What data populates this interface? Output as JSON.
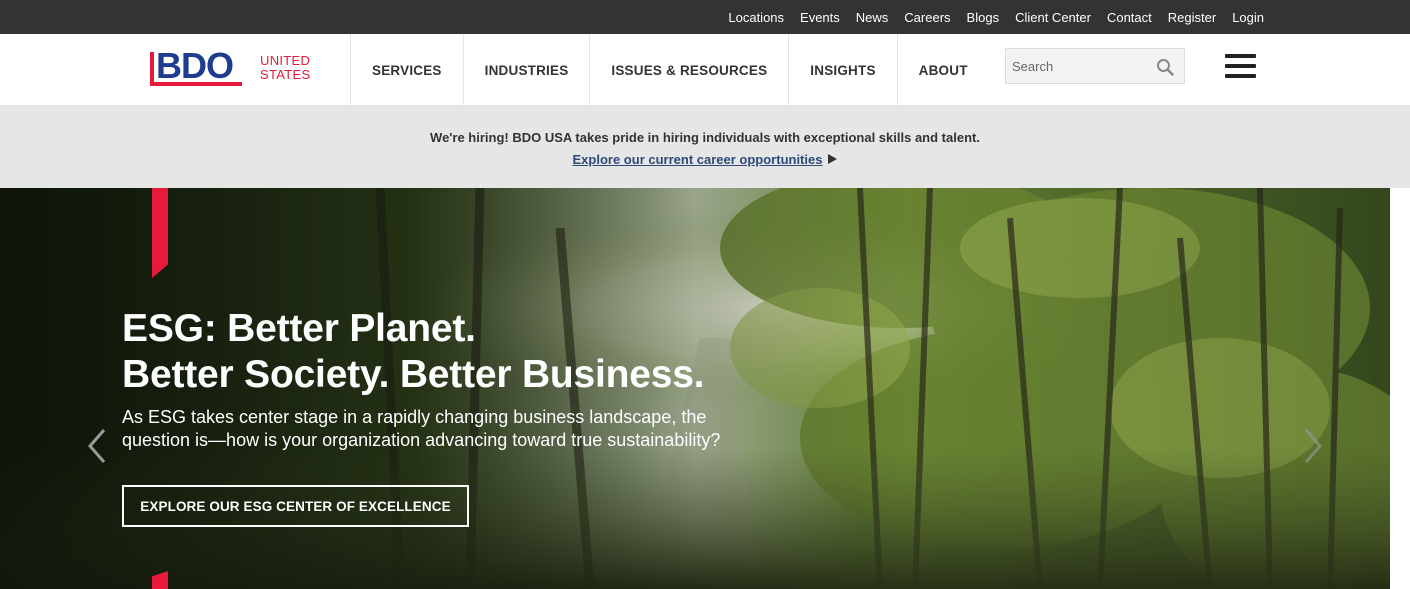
{
  "utility_nav": [
    "Locations",
    "Events",
    "News",
    "Careers",
    "Blogs",
    "Client Center",
    "Contact",
    "Register",
    "Login"
  ],
  "logo": {
    "letters": "BDO",
    "country_line1": "UNITED",
    "country_line2": "STATES"
  },
  "main_nav": [
    "SERVICES",
    "INDUSTRIES",
    "ISSUES & RESOURCES",
    "INSIGHTS",
    "ABOUT"
  ],
  "search": {
    "placeholder": "Search"
  },
  "hiring": {
    "message": "We're hiring! BDO USA takes pride in hiring individuals with exceptional skills and talent.",
    "link": "Explore our current career opportunities"
  },
  "hero": {
    "title_line1": "ESG: Better Planet.",
    "title_line2": "Better Society. Better Business.",
    "subtitle": "As ESG takes center stage in a rapidly changing business landscape, the question is—how is your organization advancing toward true sustainability?",
    "cta": "EXPLORE OUR ESG CENTER OF EXCELLENCE"
  },
  "colors": {
    "brand_red": "#e81a3b",
    "brand_blue": "#1f3d8f",
    "utility_bg": "#333333"
  }
}
